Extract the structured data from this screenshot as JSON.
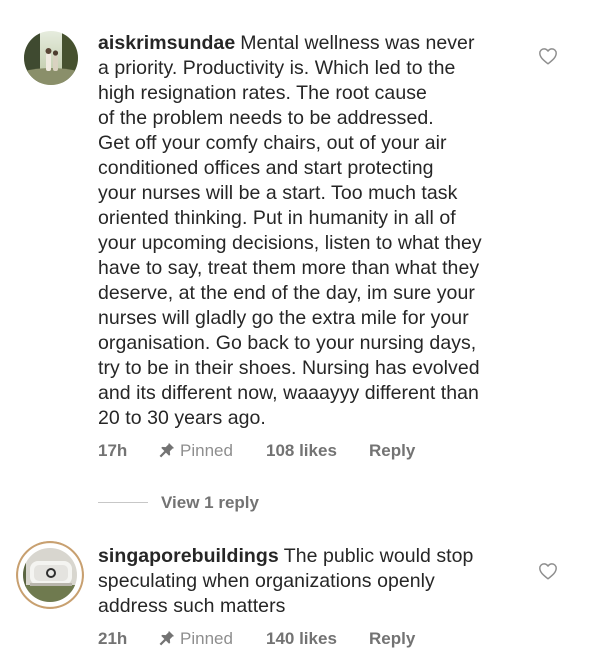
{
  "comments": [
    {
      "username": "aiskrimsundae",
      "text": "Mental wellness was never\na priority. Productivity is. Which led to the\nhigh resignation rates. The root cause\nof the problem needs to be addressed.\nGet off your comfy chairs, out of your air\nconditioned offices and start protecting\nyour nurses will be a start. Too much task\noriented thinking. Put in humanity in all of\nyour upcoming decisions, listen to what they\nhave to say, treat them more than what they\ndeserve, at the end of the day, im sure your\nnurses will gladly go the extra mile for your\norganisation. Go back to your nursing days,\ntry to be in their shoes. Nursing has evolved\nand its different now, waaayyy different than\n20 to 30 years ago.",
      "time": "17h",
      "pinned_label": "Pinned",
      "likes": "108 likes",
      "reply_label": "Reply"
    },
    {
      "username": "singaporebuildings",
      "text": "The public would stop\nspeculating when organizations openly\naddress such matters",
      "time": "21h",
      "pinned_label": "Pinned",
      "likes": "140 likes",
      "reply_label": "Reply"
    }
  ],
  "view_replies_label": "View 1 reply",
  "icons": {
    "like": "heart-outline-icon",
    "pin": "pin-icon"
  },
  "colors": {
    "text": "#262626",
    "secondary": "#737373",
    "story_ring": "#c8a070"
  }
}
